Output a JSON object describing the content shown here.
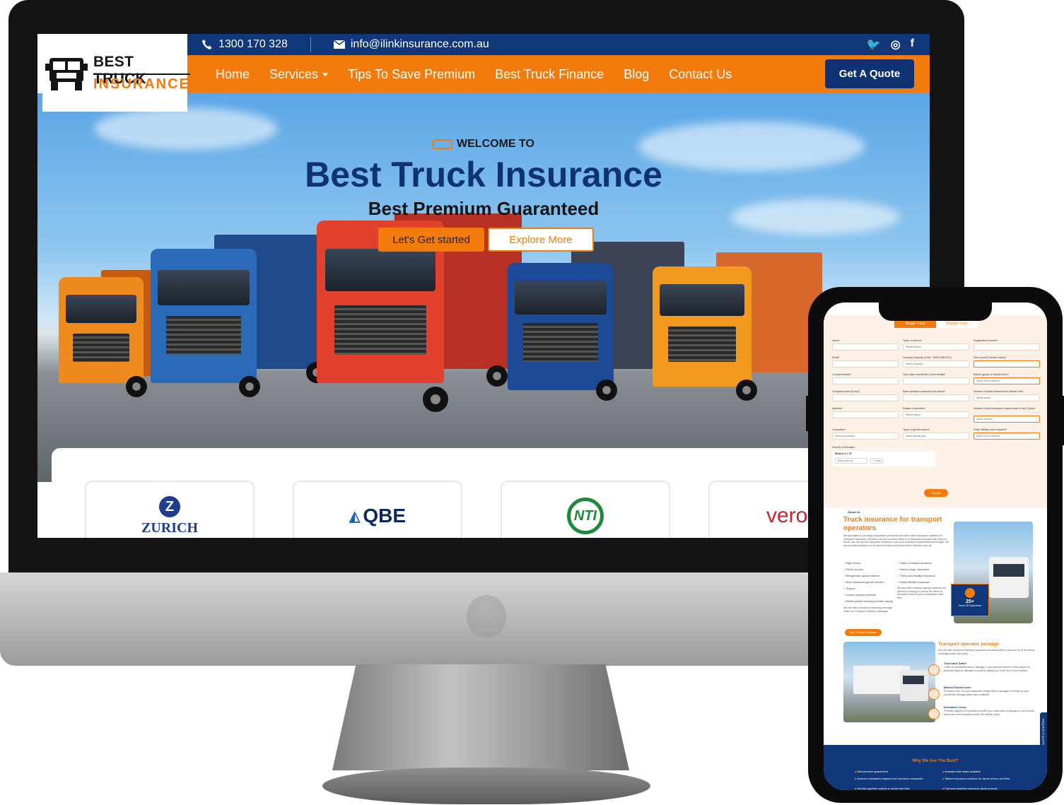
{
  "desktop": {
    "topbar": {
      "phone": "1300 170 328",
      "email": "info@ilinkinsurance.com.au",
      "social": [
        "twitter-icon",
        "instagram-icon",
        "facebook-icon"
      ]
    },
    "logo": {
      "line1": "BEST TRUCK",
      "line2": "INSURANCE"
    },
    "nav": {
      "items": [
        "Home",
        "Services",
        "Tips To Save Premium",
        "Best Truck Finance",
        "Blog",
        "Contact Us"
      ],
      "cta": "Get A Quote"
    },
    "hero": {
      "welcome": "WELCOME TO",
      "title": "Best Truck Insurance",
      "subtitle": "Best Premium Guaranteed",
      "primary_btn": "Let's Get started",
      "secondary_btn": "Explore More"
    },
    "partners": [
      "ZURICH",
      "QBE",
      "NTI",
      "vero"
    ],
    "colors": {
      "brand_orange": "#f37b0c",
      "brand_navy": "#10377a"
    }
  },
  "mobile": {
    "tabs": [
      "Single Truck",
      "Multiple Truck"
    ],
    "form": {
      "col1": [
        {
          "label": "Name*",
          "value": ""
        },
        {
          "label": "Email*",
          "value": ""
        },
        {
          "label": "Contact Number*",
          "value": ""
        },
        {
          "label": "Company Name (if any)*",
          "value": ""
        },
        {
          "label": "Address*",
          "value": ""
        },
        {
          "label": "Occupation*",
          "value": "Select occupation"
        }
      ],
      "col2": [
        {
          "label": "Types of vehicle*",
          "value": "Please Select"
        },
        {
          "label": "Carrying Capacity (GVM - TARE WEIGHT)*",
          "value": "Select capacity"
        },
        {
          "label": "Year, Make and Model (Truck details)*",
          "value": ""
        },
        {
          "label": "Base operation postcode and suburb*",
          "value": ""
        },
        {
          "label": "Radius of operation*",
          "value": "Select radius"
        },
        {
          "label": "Types of goods carried*",
          "value": "Select goods type"
        }
      ],
      "col3": [
        {
          "label": "Registration Number*",
          "value": ""
        },
        {
          "label": "Sum insured (Vehicle value)*",
          "value": ""
        },
        {
          "label": "Marine (goods in transit cover)*",
          "value": "Select cover amount"
        },
        {
          "label": "Number of years relevant truck license held*",
          "value": "Select years"
        },
        {
          "label": "Number of truck insurance claims made in last 5 years*",
          "value": "Select number"
        },
        {
          "label": "Public liability cover required*",
          "value": "Select cover amount"
        }
      ],
      "security_label": "Security Verification *",
      "security_question": "What is 3 + 5?",
      "security_placeholder": "Enter your an",
      "security_refresh": "↻ New",
      "submit": "Submit"
    },
    "about": {
      "tag": "About Us",
      "heading": "Truck insurance for transport operators",
      "body": "We specialize in providing competitive premiums and tailor made insurance solutions for Transport Operators. Whether you are an owner driver or a transport company with fleets of trucks, we can provide insurance solutions to suit your business requirements and budget. We can provide insurance for all kinds of trucks and heavy Motor Vehicles such as:",
      "list_left": [
        "Rigid trucks",
        "Prime movers",
        "Refrigerator goods carriers",
        "Bulk hazardous goods carriers",
        "Tippers",
        "Goods carrying vehicles",
        "Mobile plants including mobile cranes"
      ],
      "list_right": [
        "Trailer & transit insurance",
        "Marine cargo insurance",
        "Third party liability insurance",
        "Public liability insurance"
      ],
      "list_right_note": "We also offer monthly payment options (via premium funding) to reduce the effect of insurance costs on your businesses cash flow.",
      "list_left_note": "We can also provide the following coverage under our Transport Operator packages",
      "experience_value": "25+",
      "experience_label": "Years Of Experience",
      "tips_btn": "Tips To Save Premium"
    },
    "package": {
      "heading": "Transport operator package",
      "intro": "We can offer combined transport operators insurance which can cover all of the above coverage under one policy.",
      "items": [
        {
          "title": "Truck and Trailer",
          "text": "Cover for accidental loss or damage to your vehicle and/or to third parties for personal injury or damage to property arising out of the use of your vehicle."
        },
        {
          "title": "Marine/Transit cover",
          "text": "Provides cover for your customer's freight that is damaged in transit by your Accidental damage option also available."
        },
        {
          "title": "Downtime Cover",
          "text": "Provides payment of a weekly benefit if you claim loss or damage to your vehicle which has been accepted under the vehicle policy."
        }
      ]
    },
    "request_tab": "REQUEST A QUOTE",
    "why": {
      "title": "Why We Are The Best?",
      "left": [
        "Best premium guaranteed",
        "Access to Australia's largest truck insurance companies",
        "Monthly payment options to assist cash flow"
      ],
      "right": [
        "Australia wide radius available",
        "Tailored insurance solutions for owner drivers and fleet",
        "Fast and seamless insurance quote process"
      ]
    }
  }
}
